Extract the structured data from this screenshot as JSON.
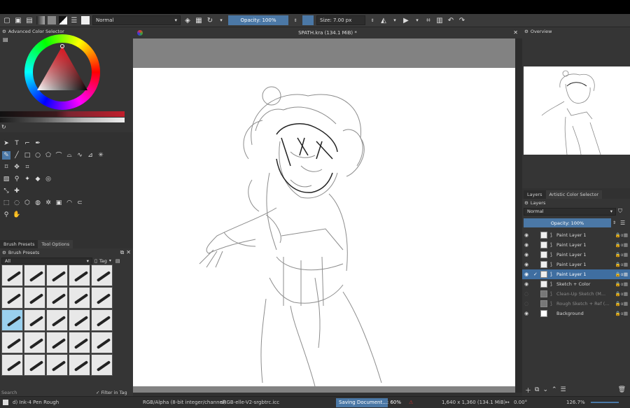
{
  "toolbar": {
    "blend_mode": "Normal",
    "opacity": "Opacity: 100%",
    "size": "Size: 7.00 px"
  },
  "color_selector": {
    "title": "Advanced Color Selector"
  },
  "tool_tabs": [
    "Brush Presets",
    "Tool Options"
  ],
  "brush_presets": {
    "title": "Brush Presets",
    "filter_value": "All",
    "tag_label": "Tag",
    "search_placeholder": "Search",
    "filter_in_tag": "Filter in Tag"
  },
  "document": {
    "title": "SPATH.kra (134.1 MiB) *"
  },
  "overview": {
    "title": "Overview"
  },
  "right_tabs": [
    "Layers",
    "Artistic Color Selector"
  ],
  "layers": {
    "title": "Layers",
    "blend_mode": "Normal",
    "opacity": "Opacity:  100%",
    "items": [
      {
        "name": "Paint Layer 1",
        "state": "normal"
      },
      {
        "name": "Paint Layer 1",
        "state": "normal"
      },
      {
        "name": "Paint Layer 1",
        "state": "normal"
      },
      {
        "name": "Paint Layer 1",
        "state": "normal"
      },
      {
        "name": "Paint Layer 1",
        "state": "selected"
      },
      {
        "name": "Sketch + Color",
        "state": "normal"
      },
      {
        "name": "Clean-Up Sketch (M...",
        "state": "dim"
      },
      {
        "name": "Rough Sketch + Ref (...",
        "state": "dim"
      },
      {
        "name": "Background",
        "state": "normal"
      }
    ]
  },
  "status": {
    "brush": "d) Ink-4 Pen Rough",
    "color_model": "RGB/Alpha (8-bit integer/channel)",
    "profile": "sRGB-elle-V2-srgbtrc.icc",
    "saving": "Saving Document...: 60%",
    "dimensions": "1,640 x 1,360 (134.1 MiB)",
    "rotation": "0.00°",
    "zoom": "126.7%"
  },
  "colors": {
    "accent": "#4b78a6",
    "panel": "#353535"
  }
}
